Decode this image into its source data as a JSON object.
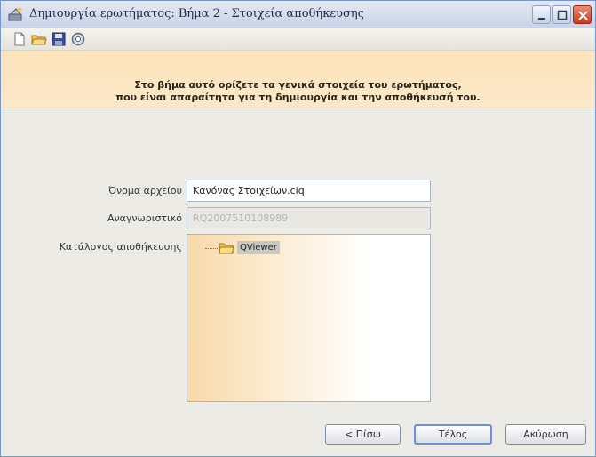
{
  "window": {
    "title": "Δημιουργία ερωτήματος: Βήμα 2 - Στοιχεία αποθήκευσης"
  },
  "toolbar": {
    "icons": [
      "new-document-icon",
      "open-folder-icon",
      "save-icon",
      "settings-icon"
    ]
  },
  "banner": {
    "line1": "Στο βήμα αυτό ορίζετε τα γενικά στοιχεία του ερωτήματος,",
    "line2": "που είναι απαραίτητα για τη δημιουργία και την αποθήκευσή του."
  },
  "form": {
    "filename_label": "Όνομα αρχείου",
    "filename_value": "Κανόνας Στοιχείων.clq",
    "identifier_label": "Αναγνωριστικό",
    "identifier_value": "RQ2007510108989",
    "directory_label": "Κατάλογος αποθήκευσης",
    "tree_node_label": "QViewer"
  },
  "buttons": {
    "back_label": "< Πίσω",
    "finish_label": "Τέλος",
    "cancel_label": "Ακύρωση"
  }
}
